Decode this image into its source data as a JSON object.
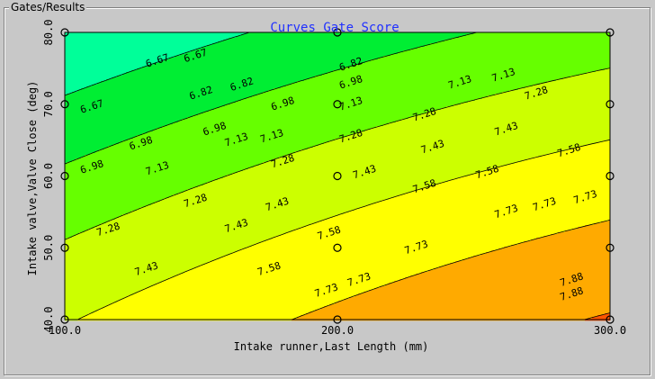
{
  "panel": {
    "title": "Gates/Results"
  },
  "chart_data": {
    "type": "contour",
    "title": "Curves Gate Score",
    "xlabel": "Intake runner,Last Length (mm)",
    "ylabel": "Intake valve,Valve Close (deg)",
    "xlim": [
      100,
      300
    ],
    "ylim": [
      40,
      80
    ],
    "x_ticks": [
      "100.0",
      "200.0",
      "300.0"
    ],
    "y_ticks": [
      "40.0",
      "50.0",
      "60.0",
      "70.0",
      "80.0"
    ],
    "levels": [
      6.67,
      6.82,
      6.98,
      7.13,
      7.28,
      7.43,
      7.58,
      7.73,
      7.88
    ],
    "level_labels": [
      "6.67",
      "6.82",
      "6.98",
      "7.13",
      "7.28",
      "7.43",
      "7.58",
      "7.73",
      "7.88"
    ],
    "band_colors": [
      "#0022dd",
      "#0099ff",
      "#00ffff",
      "#00ff99",
      "#00ee33",
      "#66ff00",
      "#ccff00",
      "#ffff00",
      "#ffaa00",
      "#ff5500",
      "#ff0000"
    ],
    "design_points": [
      {
        "x": 100,
        "y": 40
      },
      {
        "x": 100,
        "y": 50
      },
      {
        "x": 100,
        "y": 60
      },
      {
        "x": 100,
        "y": 70
      },
      {
        "x": 100,
        "y": 80
      },
      {
        "x": 200,
        "y": 40
      },
      {
        "x": 200,
        "y": 50
      },
      {
        "x": 200,
        "y": 60
      },
      {
        "x": 200,
        "y": 70
      },
      {
        "x": 200,
        "y": 80
      },
      {
        "x": 300,
        "y": 40
      },
      {
        "x": 300,
        "y": 50
      },
      {
        "x": 300,
        "y": 60
      },
      {
        "x": 300,
        "y": 70
      },
      {
        "x": 300,
        "y": 80
      }
    ],
    "contour_labels": [
      {
        "text": "6.67",
        "x": 134,
        "y": 76.0
      },
      {
        "text": "6.67",
        "x": 148,
        "y": 76.7
      },
      {
        "text": "6.67",
        "x": 110,
        "y": 69.6
      },
      {
        "text": "6.82",
        "x": 150,
        "y": 71.5
      },
      {
        "text": "6.82",
        "x": 165,
        "y": 72.7
      },
      {
        "text": "6.82",
        "x": 205,
        "y": 75.5
      },
      {
        "text": "6.98",
        "x": 110,
        "y": 61.2
      },
      {
        "text": "6.98",
        "x": 128,
        "y": 64.5
      },
      {
        "text": "6.98",
        "x": 155,
        "y": 66.5
      },
      {
        "text": "6.98",
        "x": 180,
        "y": 70.0
      },
      {
        "text": "6.98",
        "x": 205,
        "y": 73.0
      },
      {
        "text": "7.13",
        "x": 134,
        "y": 61.0
      },
      {
        "text": "7.13",
        "x": 163,
        "y": 65.0
      },
      {
        "text": "7.13",
        "x": 176,
        "y": 65.5
      },
      {
        "text": "7.13",
        "x": 205,
        "y": 70.0
      },
      {
        "text": "7.13",
        "x": 245,
        "y": 73.0
      },
      {
        "text": "7.13",
        "x": 261,
        "y": 74.0
      },
      {
        "text": "7.28",
        "x": 116,
        "y": 52.5
      },
      {
        "text": "7.28",
        "x": 148,
        "y": 56.5
      },
      {
        "text": "7.28",
        "x": 180,
        "y": 62.0
      },
      {
        "text": "7.28",
        "x": 205,
        "y": 65.5
      },
      {
        "text": "7.28",
        "x": 232,
        "y": 68.5
      },
      {
        "text": "7.28",
        "x": 273,
        "y": 71.5
      },
      {
        "text": "7.43",
        "x": 130,
        "y": 47.0
      },
      {
        "text": "7.43",
        "x": 163,
        "y": 53.0
      },
      {
        "text": "7.43",
        "x": 178,
        "y": 56.0
      },
      {
        "text": "7.43",
        "x": 210,
        "y": 60.5
      },
      {
        "text": "7.43",
        "x": 235,
        "y": 64.0
      },
      {
        "text": "7.43",
        "x": 262,
        "y": 66.5
      },
      {
        "text": "7.58",
        "x": 175,
        "y": 47.0
      },
      {
        "text": "7.58",
        "x": 197,
        "y": 52.0
      },
      {
        "text": "7.58",
        "x": 232,
        "y": 58.5
      },
      {
        "text": "7.58",
        "x": 255,
        "y": 60.5
      },
      {
        "text": "7.58",
        "x": 285,
        "y": 63.5
      },
      {
        "text": "7.73",
        "x": 196,
        "y": 44.0
      },
      {
        "text": "7.73",
        "x": 208,
        "y": 45.5
      },
      {
        "text": "7.73",
        "x": 229,
        "y": 50.0
      },
      {
        "text": "7.73",
        "x": 262,
        "y": 55.0
      },
      {
        "text": "7.73",
        "x": 276,
        "y": 56.0
      },
      {
        "text": "7.73",
        "x": 291,
        "y": 57.0
      },
      {
        "text": "7.88",
        "x": 286,
        "y": 43.5
      },
      {
        "text": "7.88",
        "x": 286,
        "y": 45.5
      }
    ]
  }
}
